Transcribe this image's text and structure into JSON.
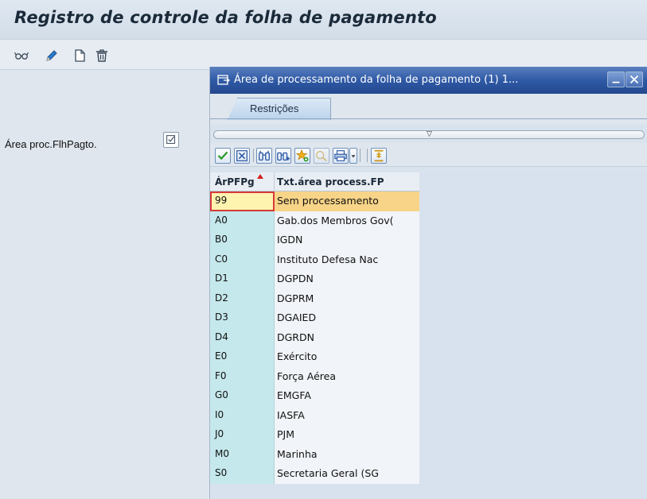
{
  "app": {
    "title": "Registro de controle da folha de pagamento"
  },
  "toolbar": {
    "icons": [
      "display-glasses-icon",
      "edit-pencil-icon",
      "new-document-icon",
      "delete-trash-icon"
    ]
  },
  "form": {
    "field_label": "Área proc.FlhPagto.",
    "value_help_icon": "value-help-check-icon"
  },
  "dialog": {
    "title": "Área de processamento da folha de pagamento (1)  1...",
    "tab_label": "Restrições",
    "splitter_glyph": "▽",
    "columns": [
      "ÁrPFPg",
      "Txt.área process.FP"
    ],
    "rows": [
      {
        "key": "99",
        "text": "Sem processamento"
      },
      {
        "key": "A0",
        "text": "Gab.dos Membros Gov("
      },
      {
        "key": "B0",
        "text": "IGDN"
      },
      {
        "key": "C0",
        "text": "Instituto Defesa Nac"
      },
      {
        "key": "D1",
        "text": "DGPDN"
      },
      {
        "key": "D2",
        "text": "DGPRM"
      },
      {
        "key": "D3",
        "text": "DGAIED"
      },
      {
        "key": "D4",
        "text": "DGRDN"
      },
      {
        "key": "E0",
        "text": "Exército"
      },
      {
        "key": "F0",
        "text": "Força Aérea"
      },
      {
        "key": "G0",
        "text": "EMGFA"
      },
      {
        "key": "I0",
        "text": "IASFA"
      },
      {
        "key": "J0",
        "text": "PJM"
      },
      {
        "key": "M0",
        "text": "Marinha"
      },
      {
        "key": "S0",
        "text": "Secretaria Geral (SG"
      }
    ]
  },
  "colors": {
    "dialog_header": "#2f5aa6",
    "key_column": "#c5e8ec",
    "selection": "#f8d488",
    "selection_border": "#d43a3a"
  }
}
